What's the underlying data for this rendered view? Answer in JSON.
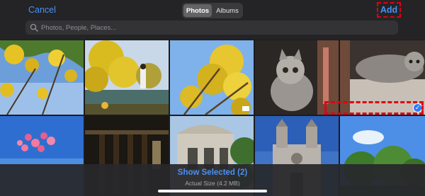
{
  "header": {
    "cancel_label": "Cancel",
    "tabs": [
      {
        "label": "Photos",
        "active": true
      },
      {
        "label": "Albums",
        "active": false
      }
    ],
    "add_label": "Add"
  },
  "search": {
    "placeholder": "Photos, People, Places..."
  },
  "photos": [
    {
      "subject": "yellow blossoms against sky",
      "selected": false
    },
    {
      "subject": "yellow tree by lake with person",
      "selected": false
    },
    {
      "subject": "yellow blossoms close-up",
      "selected": false,
      "video": true
    },
    {
      "subject": "tabby cat sitting",
      "selected": false
    },
    {
      "subject": "tabby cat lying on sofa",
      "selected": true
    },
    {
      "subject": "pink heart balloons in blue sky",
      "selected": false
    },
    {
      "subject": "dark building interior",
      "selected": false
    },
    {
      "subject": "ornate building facade with trees",
      "selected": false
    },
    {
      "subject": "church with twin towers",
      "selected": false
    },
    {
      "subject": "green trees under blue sky",
      "selected": false
    }
  ],
  "footer": {
    "show_selected_label": "Show Selected (2)",
    "actual_size_label": "Actual Size (4.2 MB)"
  },
  "colors": {
    "accent": "#4a90f5",
    "highlight": "#e00012"
  }
}
